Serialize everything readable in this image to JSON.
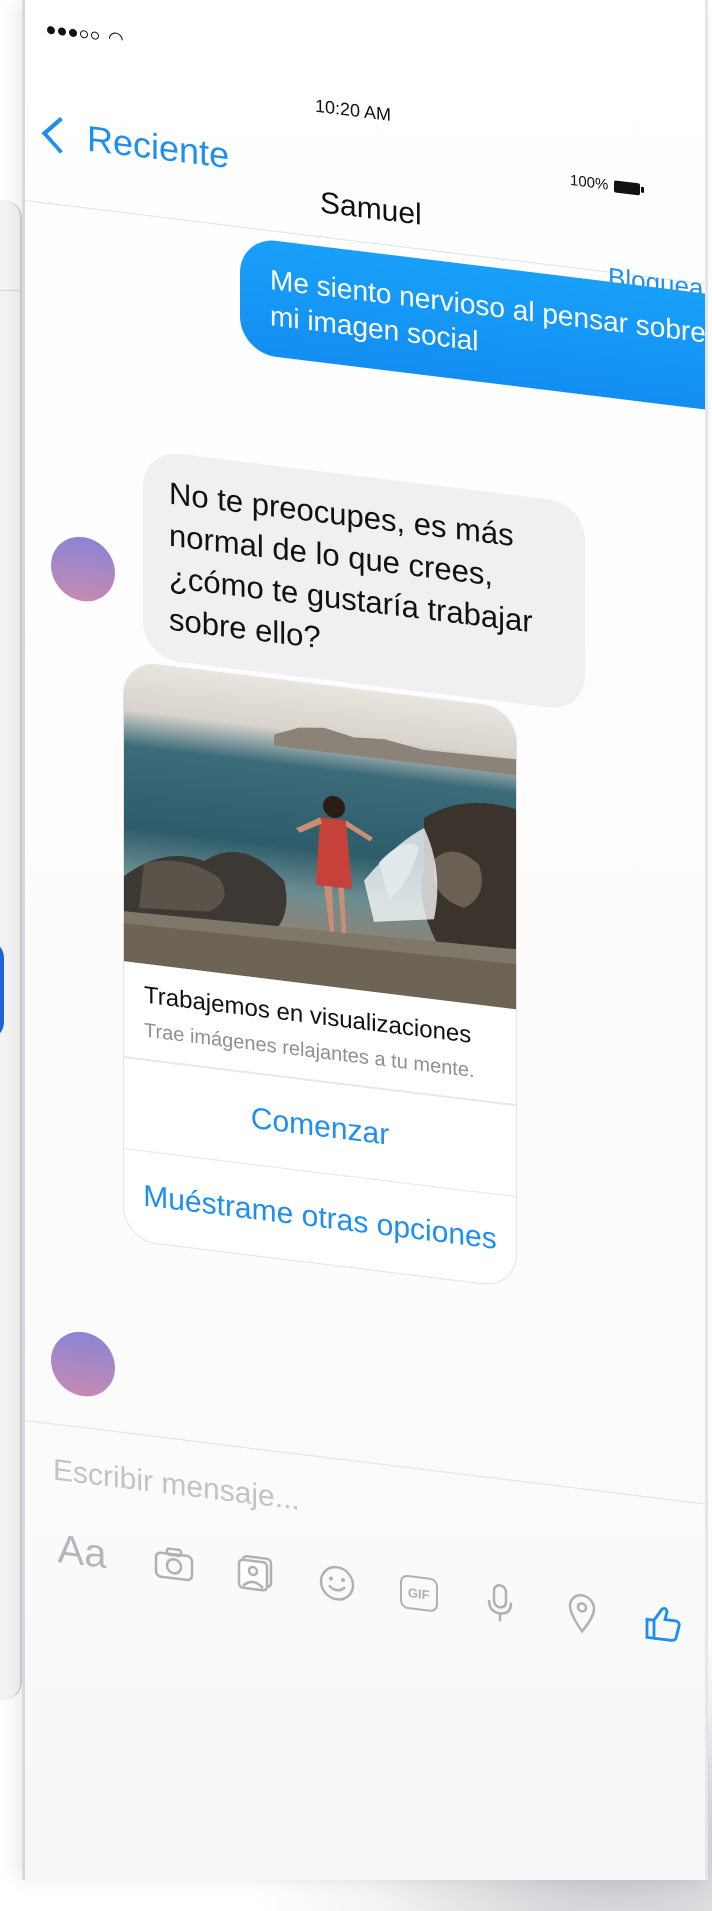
{
  "status_bar": {
    "time": "10:20 AM",
    "battery": "100%",
    "signal_icon": "signal-dots-icon",
    "wifi_icon": "wifi-icon"
  },
  "nav": {
    "back_label": "Reciente",
    "title": "Samuel",
    "action_label": "Bloquear"
  },
  "messages": {
    "outgoing": "Me siento nervioso al pensar sobre mi imagen social",
    "incoming": "No te preocupes, es más normal de lo que crees, ¿cómo te gustaría trabajar sobre ello?"
  },
  "card": {
    "title": "Trabajemos en visualizaciones",
    "subtitle": "Trae imágenes relajantes a tu mente.",
    "primary_button": "Comenzar",
    "secondary_button": "Muéstrame otras opciones"
  },
  "composer": {
    "placeholder": "Escribir mensaje...",
    "aa_label": "Aa",
    "gif_label": "GIF",
    "icons": [
      "aa-icon",
      "camera-icon",
      "photo-icon",
      "emoji-icon",
      "gif-icon",
      "microphone-icon",
      "location-icon",
      "thumbs-up-icon"
    ]
  },
  "colors": {
    "accent": "#1F8EF1",
    "outgoing_bubble": "#18A0F9",
    "incoming_bubble": "#F0F0F2"
  }
}
